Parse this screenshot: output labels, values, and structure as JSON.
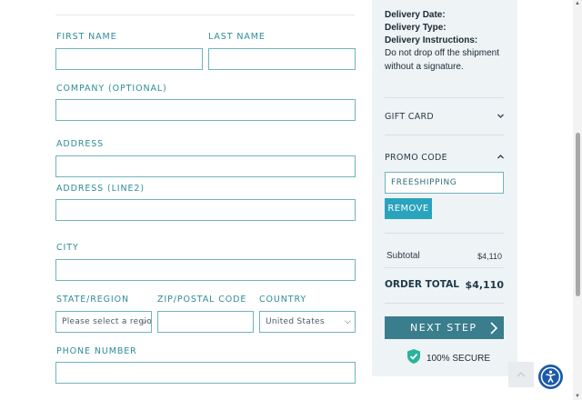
{
  "form": {
    "first_name_label": "FIRST NAME",
    "last_name_label": "LAST NAME",
    "company_label": "COMPANY (OPTIONAL)",
    "address_label": "ADDRESS",
    "address2_label": "ADDRESS (LINE2)",
    "city_label": "CITY",
    "state_label": "STATE/REGION",
    "state_value": "Please select a region",
    "zip_label": "ZIP/POSTAL CODE",
    "country_label": "COUNTRY",
    "country_value": "United States",
    "phone_label": "PHONE NUMBER",
    "first_name_value": "",
    "last_name_value": "",
    "company_value": "",
    "address_value": "",
    "address2_value": "",
    "city_value": "",
    "zip_value": "",
    "phone_value": ""
  },
  "summary": {
    "delivery_date_label": "Delivery Date:",
    "delivery_type_label": "Delivery Type:",
    "delivery_instructions_label": "Delivery Instructions:",
    "delivery_instructions_line1": "Do not drop off the shipment",
    "delivery_instructions_line2": "without a signature.",
    "gift_card_label": "GIFT CARD",
    "promo_code_label": "PROMO CODE",
    "promo_code_value": "FREESHIPPING",
    "remove_label": "REMOVE",
    "subtotal_label": "Subtotal",
    "subtotal_value": "$4,110",
    "order_total_label": "ORDER TOTAL",
    "order_total_value": "$4,110",
    "next_step_label": "NEXT STEP",
    "secure_label": "100% SECURE"
  },
  "icons": {
    "chevron_down": "chevron-down-icon",
    "chevron_up": "chevron-up-icon",
    "arrow_right": "arrow-right-icon",
    "shield_check": "shield-check-icon",
    "accessibility": "accessibility-icon",
    "back_to_top": "chevron-up-icon"
  },
  "colors": {
    "accent_teal": "#2f8c98",
    "field_border": "#6fb4bd",
    "remove_button": "#2aa3bd",
    "next_button": "#3a7d8c",
    "panel_bg": "#eef3f6",
    "secure_shield": "#2bb39b",
    "accessibility_button": "#1b5aa8"
  }
}
